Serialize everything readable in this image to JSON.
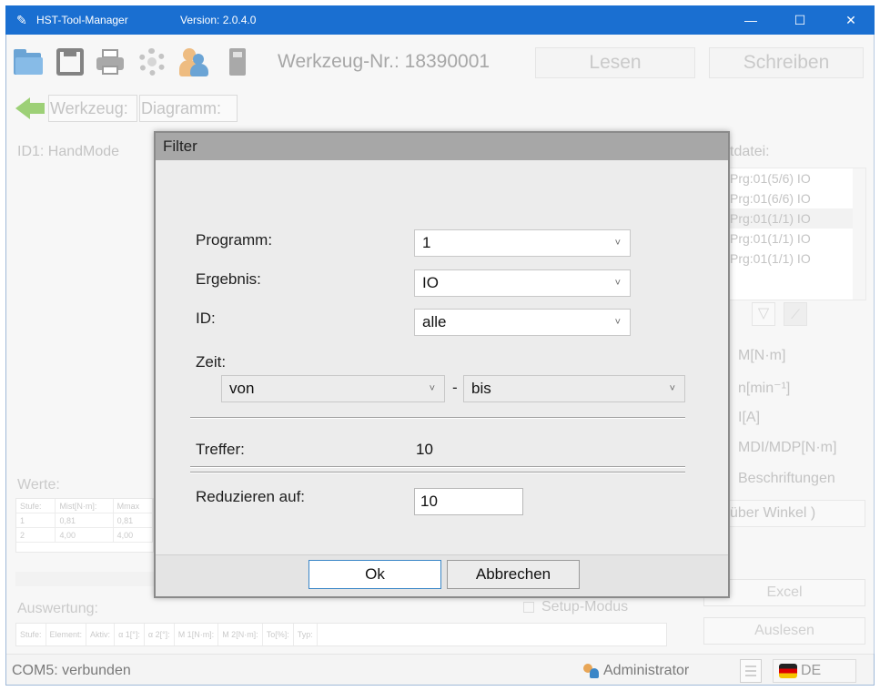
{
  "titlebar": {
    "title": "HST-Tool-Manager",
    "version": "Version: 2.0.4.0",
    "minimize": "—",
    "maximize": "☐",
    "close": "✕"
  },
  "toolbar": {
    "werkzeug_nr": "Werkzeug-Nr.: 18390001",
    "lesen": "Lesen",
    "schreiben": "Schreiben"
  },
  "nav": {
    "werkzeug": "Werkzeug:",
    "diagramm": "Diagramm:"
  },
  "left": {
    "id_label": "ID1:  HandMode",
    "werte_label": "Werte:",
    "werte_headers": [
      "Stufe:",
      "Mist[N·m]:",
      "Mmax"
    ],
    "werte_rows": [
      [
        "1",
        "0,81",
        "0,81"
      ],
      [
        "2",
        "4,00",
        "4,00"
      ]
    ],
    "auswertung_label": "Auswertung:",
    "setup_modus": "Setup-Modus",
    "auswertung_headers": [
      "Stufe:",
      "Element:",
      "Aktiv:",
      "α 1[°]:",
      "α 2[°]:",
      "M 1[N·m]:",
      "M 2[N·m]:",
      "To[%]:",
      "Typ:"
    ]
  },
  "right": {
    "datei_label": "tdatei:",
    "files": [
      "Prg:01(5/6) IO",
      "Prg:01(6/6) IO",
      "Prg:01(1/1) IO",
      "Prg:01(1/1) IO",
      "Prg:01(1/1) IO"
    ],
    "selected_file_index": 2,
    "filter_glyph": "▽",
    "chart_glyph": "⟋",
    "legend": [
      "M[N·m]",
      "n[min⁻¹]",
      "I[A]",
      "MDI/MDP[N·m]",
      "Beschriftungen"
    ],
    "winkel": "über Winkel )",
    "excel": "Excel",
    "auslesen": "Auslesen"
  },
  "status": {
    "connection": "COM5: verbunden",
    "user": "Administrator",
    "language": "DE"
  },
  "dialog": {
    "title": "Filter",
    "programm_label": "Programm:",
    "programm_value": "1",
    "ergebnis_label": "Ergebnis:",
    "ergebnis_value": "IO",
    "id_label": "ID:",
    "id_value": "alle",
    "zeit_label": "Zeit:",
    "von": "von",
    "dash": "-",
    "bis": "bis",
    "treffer_label": "Treffer:",
    "treffer_value": "10",
    "reduzieren_label": "Reduzieren auf:",
    "reduzieren_value": "10",
    "ok": "Ok",
    "abbrechen": "Abbrechen",
    "chevron": "˅"
  }
}
